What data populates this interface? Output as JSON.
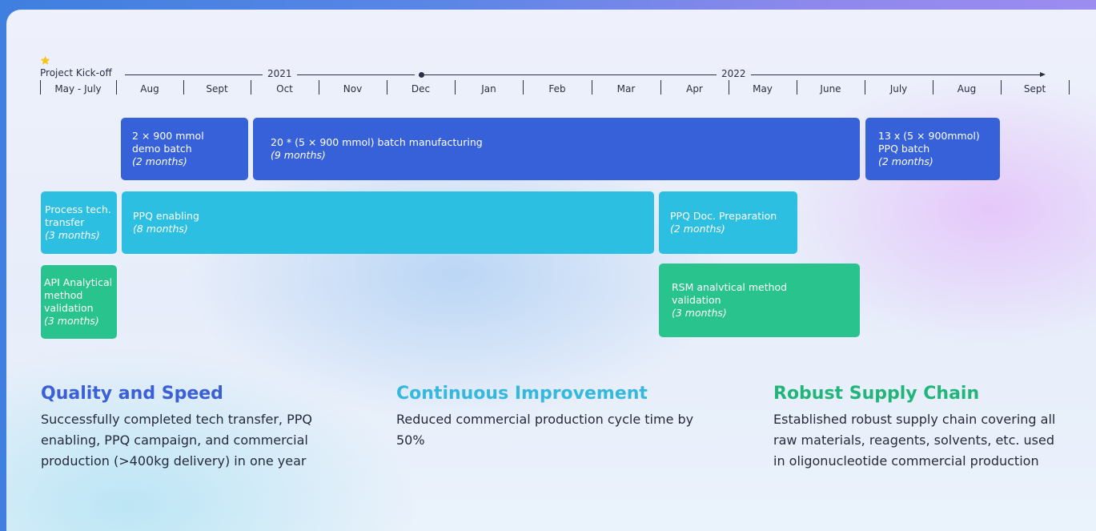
{
  "colors": {
    "phase_blue": "#3761d9",
    "phase_cyan": "#2cbfe1",
    "phase_green": "#29c38d",
    "title_blue": "#3a5fd6",
    "title_cyan": "#36b8de",
    "title_green": "#22b57a",
    "star": "#f5c518"
  },
  "timeline": {
    "kickoff_label": "Project Kick-off",
    "kickoff_icon": "star-icon",
    "year_2021": "2021",
    "year_2022": "2022",
    "months": [
      "May - July",
      "Aug",
      "Sept",
      "Oct",
      "Nov",
      "Dec",
      "Jan",
      "Feb",
      "Mar",
      "Apr",
      "May",
      "June",
      "July",
      "Aug",
      "Sept"
    ]
  },
  "bars": {
    "demo_batch": {
      "label": "2 × 900 mmol demo batch",
      "duration": "(2 months)"
    },
    "batch_manufacturing": {
      "label": "20 * (5 × 900 mmol) batch manufacturing",
      "duration": "(9 months)"
    },
    "ppq_batch": {
      "label": "13 x (5 × 900mmol) PPQ batch",
      "duration": "(2 months)"
    },
    "process_tech_transfer": {
      "label": "Process tech. transfer",
      "duration": "(3 months)"
    },
    "ppq_enabling": {
      "label": "PPQ enabling",
      "duration": "(8 months)"
    },
    "ppq_doc_preparation": {
      "label": "PPQ Doc. Preparation",
      "duration": "(2 months)"
    },
    "api_analytical": {
      "label": "API Analytical method validation",
      "duration": "(3 months)"
    },
    "rsm_analytical": {
      "label": "RSM analvtical method validation",
      "duration": "(3 months)"
    }
  },
  "highlights": {
    "quality": {
      "title": "Quality and Speed",
      "body": "Successfully completed tech transfer, PPQ enabling, PPQ campaign, and commercial production (>400kg delivery) in one year"
    },
    "improvement": {
      "title": "Continuous Improvement",
      "body": "Reduced commercial production cycle time by 50%"
    },
    "supply": {
      "title": "Robust Supply Chain",
      "body": "Established robust supply chain covering all raw materials, reagents, solvents, etc. used in oligonucleotide commercial production"
    }
  }
}
